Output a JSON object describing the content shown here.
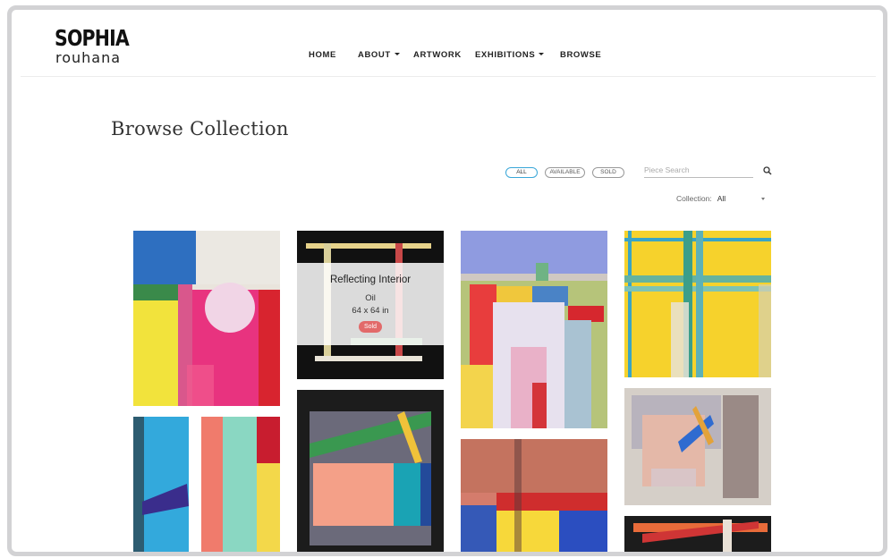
{
  "brand": {
    "name_top": "SOPHIA",
    "name_bottom": "rouhana"
  },
  "nav": [
    {
      "label": "HOME",
      "dropdown": false
    },
    {
      "label": "ABOUT",
      "dropdown": true
    },
    {
      "label": "ARTWORK",
      "dropdown": false
    },
    {
      "label": "EXHIBITIONS",
      "dropdown": true
    },
    {
      "label": "BROWSE",
      "dropdown": false
    }
  ],
  "page": {
    "title": "Browse Collection"
  },
  "filters": {
    "all": "ALL",
    "available": "AVAILABLE",
    "sold": "SOLD",
    "active": "ALL"
  },
  "search": {
    "placeholder": "Piece Search"
  },
  "collection": {
    "label": "Collection:",
    "value": "All"
  },
  "hovered_artwork": {
    "title": "Reflecting Interior",
    "medium": "Oil",
    "size": "64 x 64 in",
    "status": "Sold"
  },
  "colors": {
    "accent": "#3aa7d8",
    "sold_badge": "#e26a6a",
    "frame": "#d2d2d4"
  }
}
